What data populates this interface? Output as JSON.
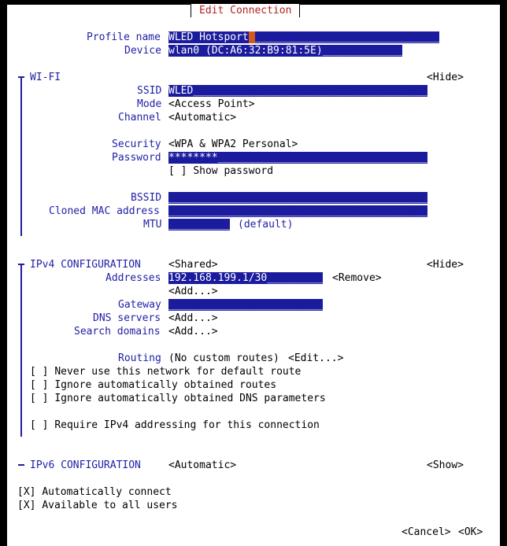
{
  "title": "Edit Connection",
  "profile": {
    "name_label": "Profile name",
    "name_value": "WLED Hotsport",
    "device_label": "Device",
    "device_value": "wlan0 (DC:A6:32:B9:81:5E)"
  },
  "wifi": {
    "section_label": "WI-FI",
    "toggle": "<Hide>",
    "ssid_label": "SSID",
    "ssid_value": "WLED",
    "mode_label": "Mode",
    "mode_value": "<Access Point>",
    "channel_label": "Channel",
    "channel_value": "<Automatic>",
    "security_label": "Security",
    "security_value": "<WPA & WPA2 Personal>",
    "password_label": "Password",
    "password_value": "********",
    "show_password_check": "[ ]",
    "show_password_label": "Show password",
    "bssid_label": "BSSID",
    "cloned_mac_label": "Cloned MAC address",
    "mtu_label": "MTU",
    "mtu_hint": "(default)"
  },
  "ipv4": {
    "section_label": "IPv4 CONFIGURATION",
    "method_value": "<Shared>",
    "toggle": "<Hide>",
    "addresses_label": "Addresses",
    "address_value": "192.168.199.1/30",
    "remove_label": "<Remove>",
    "add_address_label": "<Add...>",
    "gateway_label": "Gateway",
    "dns_label": "DNS servers",
    "dns_add_label": "<Add...>",
    "search_label": "Search domains",
    "search_add_label": "<Add...>",
    "routing_label": "Routing",
    "routing_value": "(No custom routes)",
    "routing_edit": "<Edit...>",
    "options": [
      {
        "check": "[ ]",
        "label": "Never use this network for default route"
      },
      {
        "check": "[ ]",
        "label": "Ignore automatically obtained routes"
      },
      {
        "check": "[ ]",
        "label": "Ignore automatically obtained DNS parameters"
      }
    ],
    "require_check": "[ ]",
    "require_label": "Require IPv4 addressing for this connection"
  },
  "ipv6": {
    "section_label": "IPv6 CONFIGURATION",
    "method_value": "<Automatic>",
    "toggle": "<Show>"
  },
  "general": {
    "auto_connect_check": "[X]",
    "auto_connect_label": "Automatically connect",
    "all_users_check": "[X]",
    "all_users_label": "Available to all users"
  },
  "buttons": {
    "cancel": "<Cancel>",
    "ok": "<OK>"
  }
}
